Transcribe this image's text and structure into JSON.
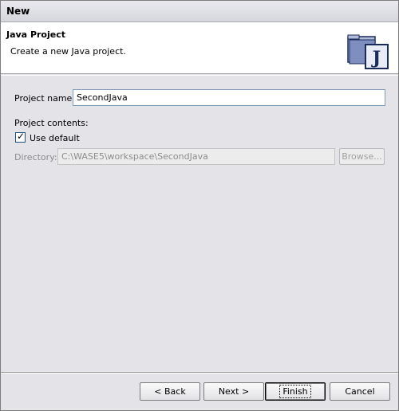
{
  "window": {
    "title": "New"
  },
  "banner": {
    "heading": "Java Project",
    "description": "Create a new Java project.",
    "icon": "java-project-icon",
    "icon_letter": "J"
  },
  "form": {
    "project_name_label": "Project name:",
    "project_name_value": "SecondJava",
    "contents_label": "Project contents:",
    "use_default_label": "Use default",
    "use_default_checked": true,
    "directory_label": "Directory:",
    "directory_value": "C:\\WASE5\\workspace\\SecondJava",
    "browse_label": "Browse..."
  },
  "buttons": {
    "back": "< Back",
    "next": "Next >",
    "finish": "Finish",
    "cancel": "Cancel"
  }
}
